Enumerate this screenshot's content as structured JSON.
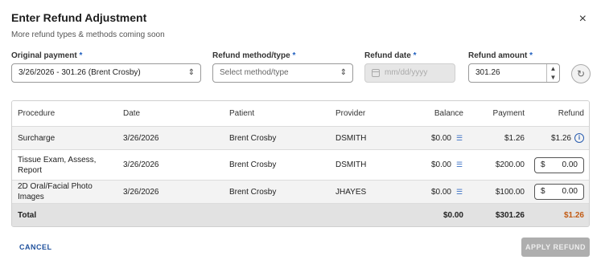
{
  "dialog": {
    "title": "Enter Refund Adjustment",
    "subtitle": "More refund types & methods coming soon",
    "close_icon": "×"
  },
  "form": {
    "original_payment": {
      "label": "Original payment",
      "required_mark": "*",
      "value": "3/26/2026 - 301.26 (Brent Crosby)"
    },
    "refund_method": {
      "label": "Refund method/type",
      "required_mark": "*",
      "placeholder": "Select method/type"
    },
    "refund_date": {
      "label": "Refund date",
      "required_mark": "*",
      "placeholder": "mm/dd/yyyy",
      "disabled": true
    },
    "refund_amount": {
      "label": "Refund amount",
      "required_mark": "*",
      "value": "301.26"
    },
    "reset_icon": "refresh-icon"
  },
  "table": {
    "headers": {
      "procedure": "Procedure",
      "date": "Date",
      "patient": "Patient",
      "provider": "Provider",
      "balance": "Balance",
      "payment": "Payment",
      "refund": "Refund"
    },
    "rows": [
      {
        "procedure": "Surcharge",
        "date": "3/26/2026",
        "patient": "Brent Crosby",
        "provider": "DSMITH",
        "balance": "$0.00",
        "payment": "$1.26",
        "refund": "$1.26"
      },
      {
        "procedure": "Tissue Exam, Assess, Report",
        "date": "3/26/2026",
        "patient": "Brent Crosby",
        "provider": "DSMITH",
        "balance": "$0.00",
        "payment": "$200.00",
        "refund_currency": "$",
        "refund_value": "0.00"
      },
      {
        "procedure": "2D Oral/Facial Photo Images",
        "date": "3/26/2026",
        "patient": "Brent Crosby",
        "provider": "JHAYES",
        "balance": "$0.00",
        "payment": "$100.00",
        "refund_currency": "$",
        "refund_value": "0.00"
      }
    ],
    "total": {
      "label": "Total",
      "balance": "$0.00",
      "payment": "$301.26",
      "refund": "$1.26"
    }
  },
  "actions": {
    "cancel": "CANCEL",
    "apply": "APPLY REFUND"
  },
  "colors": {
    "accent": "#1d4f9c",
    "refund_total": "#c25b14",
    "disabled_button": "#aeaeae"
  }
}
